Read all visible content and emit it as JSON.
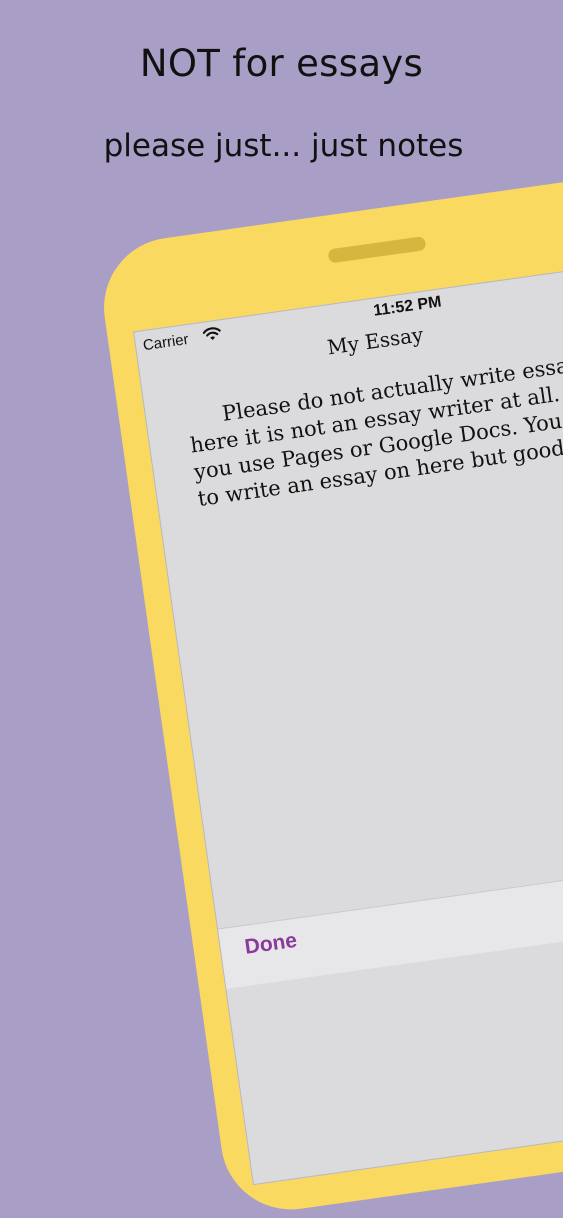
{
  "headline": {
    "title": "NOT for essays",
    "subtitle": "please just... just notes"
  },
  "status_bar": {
    "carrier": "Carrier",
    "time": "11:52 PM"
  },
  "note": {
    "title": "My Essay",
    "body_lines": [
      "Please do not actually write essays",
      "here it is not an essay writer at all. I s",
      "you use Pages or Google Docs. You cou",
      "to write an essay on here but good lu"
    ]
  },
  "toolbar": {
    "done_label": "Done"
  },
  "colors": {
    "background": "#a99ec5",
    "device_frame": "#fad961",
    "screen": "#dbdbdd",
    "accent": "#8a3a9c"
  },
  "icons": {
    "wifi": "wifi-icon"
  }
}
